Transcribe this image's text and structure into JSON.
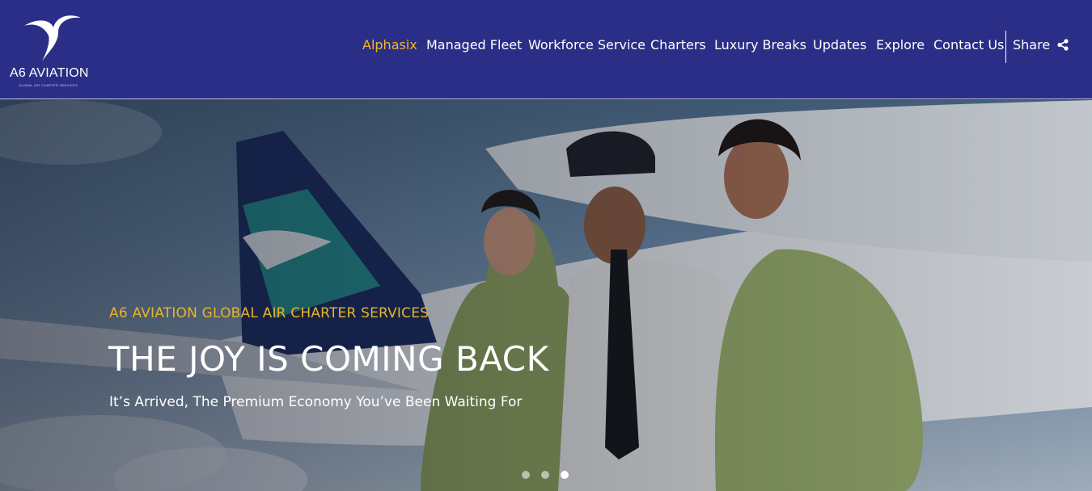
{
  "brand": {
    "name": "A6 AVIATION",
    "tagline": "GLOBAL AIR CHARTER SERVICES",
    "color": "#2b2e86",
    "accent": "#f2b824"
  },
  "nav": {
    "items": [
      {
        "label": "Alphasix",
        "active": true
      },
      {
        "label": "Managed Fleet",
        "active": false
      },
      {
        "label": "Workforce Service",
        "active": false
      },
      {
        "label": "Charters",
        "active": false
      },
      {
        "label": "Luxury Breaks",
        "active": false
      },
      {
        "label": "Updates",
        "active": false
      },
      {
        "label": "Explore",
        "active": false
      },
      {
        "label": "Contact Us",
        "active": false
      }
    ],
    "share_label": "Share",
    "share_icon": "share-icon"
  },
  "hero": {
    "kicker": "A6 AVIATION GLOBAL AIR CHARTER SERVICES",
    "title": "THE JOY IS COMING BACK",
    "subtitle": "It’s Arrived, The Premium Economy You’ve Been Waiting For",
    "slides": {
      "count": 3,
      "active_index": 2
    }
  }
}
